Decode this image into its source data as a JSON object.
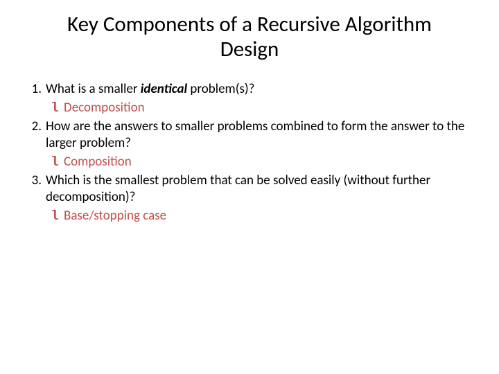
{
  "title_line1": "Key Components of a Recursive Algorithm",
  "title_line2": "Design",
  "items": [
    {
      "num": "1.",
      "q_pre": "What is a smaller ",
      "q_em": "identical",
      "q_post": " problem(s)?",
      "sub_bullet": "l",
      "sub": "Decomposition"
    },
    {
      "num": "2.",
      "q": "How are the answers to smaller problems combined to form the answer to the larger problem?",
      "sub_bullet": "l",
      "sub": "Composition"
    },
    {
      "num": "3.",
      "q": "Which is the smallest problem that can be solved easily (without further decomposition)?",
      "sub_bullet": "l",
      "sub": "Base/stopping case"
    }
  ]
}
